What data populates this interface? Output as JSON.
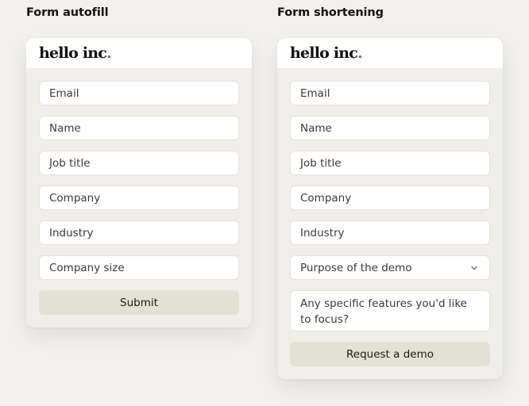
{
  "left": {
    "title": "Form autofill",
    "logo": {
      "text": "hello inc",
      "dot": "."
    },
    "fields": [
      "Email",
      "Name",
      "Job title",
      "Company",
      "Industry",
      "Company size"
    ],
    "submit_label": "Submit"
  },
  "right": {
    "title": "Form shortening",
    "logo": {
      "text": "hello inc",
      "dot": "."
    },
    "fields": [
      "Email",
      "Name",
      "Job title",
      "Company",
      "Industry"
    ],
    "select": {
      "value": "Purpose of the demo",
      "icon": "chevron-down-icon"
    },
    "textarea_placeholder": "Any specific features you'd like to focus?",
    "submit_label": "Request a demo"
  },
  "colors": {
    "page_bg": "#f2f1ed",
    "card_bg": "#efeeea",
    "button_bg": "#e3e0d7",
    "logo_dot": "#c5522f"
  }
}
